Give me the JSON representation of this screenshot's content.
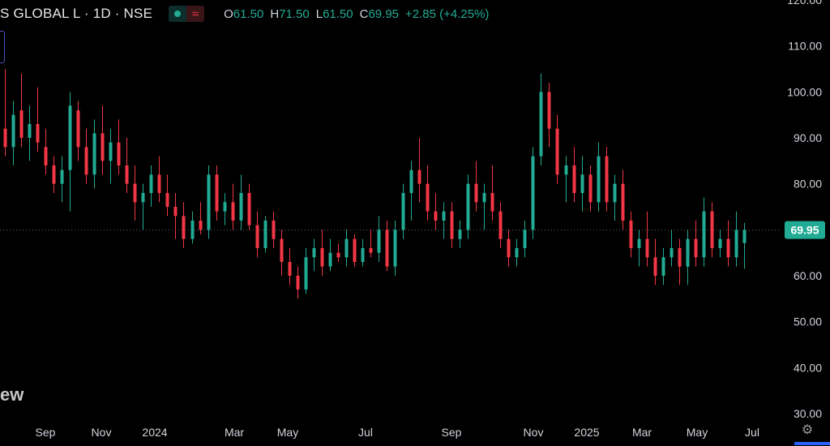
{
  "header": {
    "symbol": "S GLOBAL L · 1D · NSE",
    "status_icon": "green-dot-icon",
    "indicator_icon": "wave-icon",
    "indicator_glyph": "≈",
    "open_label": "O",
    "open": "61.50",
    "high_label": "H",
    "high": "71.50",
    "low_label": "L",
    "low": "61.50",
    "close_label": "C",
    "close": "69.95",
    "change": "+2.85 (+4.25%)"
  },
  "watermark": "ew",
  "settings_icon": "settings-icon",
  "price_label": "69.95",
  "colors": {
    "up": "#22ab94",
    "down": "#f23645",
    "background": "#000000",
    "axis_text": "#d1d4dc"
  },
  "chart_data": {
    "type": "candlestick",
    "ylim": [
      30,
      120
    ],
    "y_ticks": [
      "120.00",
      "110.00",
      "100.00",
      "90.00",
      "80.00",
      "70.00",
      "60.00",
      "50.00",
      "40.00",
      "30.00"
    ],
    "x_ticks": [
      "Sep",
      "Nov",
      "2024",
      "Mar",
      "May",
      "Jul",
      "Sep",
      "Nov",
      "2025",
      "Mar",
      "May",
      "Jul"
    ],
    "last_price": 69.95,
    "series": [
      {
        "o": 92,
        "h": 105,
        "l": 86,
        "c": 88
      },
      {
        "o": 88,
        "h": 98,
        "l": 84,
        "c": 95
      },
      {
        "o": 96,
        "h": 104,
        "l": 88,
        "c": 90
      },
      {
        "o": 90,
        "h": 97,
        "l": 85,
        "c": 93
      },
      {
        "o": 93,
        "h": 101,
        "l": 87,
        "c": 89
      },
      {
        "o": 88,
        "h": 92,
        "l": 82,
        "c": 84
      },
      {
        "o": 84,
        "h": 86,
        "l": 78,
        "c": 80
      },
      {
        "o": 80,
        "h": 86,
        "l": 76,
        "c": 83
      },
      {
        "o": 83,
        "h": 100,
        "l": 74,
        "c": 97
      },
      {
        "o": 96,
        "h": 98,
        "l": 85,
        "c": 88
      },
      {
        "o": 88,
        "h": 92,
        "l": 80,
        "c": 82
      },
      {
        "o": 82,
        "h": 94,
        "l": 79,
        "c": 91
      },
      {
        "o": 91,
        "h": 97,
        "l": 82,
        "c": 85
      },
      {
        "o": 85,
        "h": 92,
        "l": 80,
        "c": 89
      },
      {
        "o": 89,
        "h": 94,
        "l": 82,
        "c": 84
      },
      {
        "o": 84,
        "h": 90,
        "l": 78,
        "c": 80
      },
      {
        "o": 80,
        "h": 84,
        "l": 72,
        "c": 76
      },
      {
        "o": 76,
        "h": 80,
        "l": 70,
        "c": 78
      },
      {
        "o": 78,
        "h": 84,
        "l": 75,
        "c": 82
      },
      {
        "o": 82,
        "h": 86,
        "l": 76,
        "c": 78
      },
      {
        "o": 78,
        "h": 82,
        "l": 73,
        "c": 75
      },
      {
        "o": 75,
        "h": 78,
        "l": 68,
        "c": 73
      },
      {
        "o": 73,
        "h": 76,
        "l": 66,
        "c": 68
      },
      {
        "o": 68,
        "h": 74,
        "l": 67,
        "c": 72
      },
      {
        "o": 72,
        "h": 76,
        "l": 69,
        "c": 70
      },
      {
        "o": 70,
        "h": 84,
        "l": 68,
        "c": 82
      },
      {
        "o": 82,
        "h": 84,
        "l": 72,
        "c": 74
      },
      {
        "o": 74,
        "h": 78,
        "l": 71,
        "c": 76
      },
      {
        "o": 76,
        "h": 80,
        "l": 70,
        "c": 72
      },
      {
        "o": 72,
        "h": 82,
        "l": 70,
        "c": 78
      },
      {
        "o": 78,
        "h": 80,
        "l": 70,
        "c": 71
      },
      {
        "o": 71,
        "h": 74,
        "l": 64,
        "c": 66
      },
      {
        "o": 66,
        "h": 73,
        "l": 65,
        "c": 72
      },
      {
        "o": 72,
        "h": 74,
        "l": 66,
        "c": 68
      },
      {
        "o": 68,
        "h": 70,
        "l": 60,
        "c": 63
      },
      {
        "o": 63,
        "h": 66,
        "l": 58,
        "c": 60
      },
      {
        "o": 60,
        "h": 62,
        "l": 55,
        "c": 57
      },
      {
        "o": 57,
        "h": 66,
        "l": 56,
        "c": 64
      },
      {
        "o": 64,
        "h": 68,
        "l": 61,
        "c": 66
      },
      {
        "o": 66,
        "h": 70,
        "l": 60,
        "c": 62
      },
      {
        "o": 62,
        "h": 68,
        "l": 61,
        "c": 65
      },
      {
        "o": 65,
        "h": 67,
        "l": 63,
        "c": 64
      },
      {
        "o": 64,
        "h": 70,
        "l": 62,
        "c": 68
      },
      {
        "o": 68,
        "h": 69,
        "l": 62,
        "c": 63
      },
      {
        "o": 63,
        "h": 68,
        "l": 62,
        "c": 66
      },
      {
        "o": 66,
        "h": 70,
        "l": 64,
        "c": 65
      },
      {
        "o": 65,
        "h": 73,
        "l": 63,
        "c": 70
      },
      {
        "o": 70,
        "h": 72,
        "l": 61,
        "c": 62
      },
      {
        "o": 62,
        "h": 72,
        "l": 60,
        "c": 70
      },
      {
        "o": 70,
        "h": 80,
        "l": 68,
        "c": 78
      },
      {
        "o": 78,
        "h": 85,
        "l": 72,
        "c": 83
      },
      {
        "o": 83,
        "h": 90,
        "l": 76,
        "c": 80
      },
      {
        "o": 80,
        "h": 84,
        "l": 72,
        "c": 74
      },
      {
        "o": 74,
        "h": 78,
        "l": 70,
        "c": 72
      },
      {
        "o": 72,
        "h": 76,
        "l": 68,
        "c": 74
      },
      {
        "o": 74,
        "h": 76,
        "l": 66,
        "c": 68
      },
      {
        "o": 68,
        "h": 72,
        "l": 66,
        "c": 70
      },
      {
        "o": 70,
        "h": 82,
        "l": 68,
        "c": 80
      },
      {
        "o": 80,
        "h": 85,
        "l": 74,
        "c": 76
      },
      {
        "o": 76,
        "h": 80,
        "l": 70,
        "c": 78
      },
      {
        "o": 78,
        "h": 84,
        "l": 72,
        "c": 74
      },
      {
        "o": 74,
        "h": 76,
        "l": 66,
        "c": 68
      },
      {
        "o": 68,
        "h": 70,
        "l": 62,
        "c": 64
      },
      {
        "o": 64,
        "h": 68,
        "l": 62,
        "c": 66
      },
      {
        "o": 66,
        "h": 72,
        "l": 64,
        "c": 70
      },
      {
        "o": 70,
        "h": 88,
        "l": 68,
        "c": 86
      },
      {
        "o": 86,
        "h": 104,
        "l": 84,
        "c": 100
      },
      {
        "o": 100,
        "h": 102,
        "l": 88,
        "c": 92
      },
      {
        "o": 92,
        "h": 95,
        "l": 80,
        "c": 82
      },
      {
        "o": 82,
        "h": 86,
        "l": 76,
        "c": 84
      },
      {
        "o": 84,
        "h": 88,
        "l": 76,
        "c": 78
      },
      {
        "o": 78,
        "h": 86,
        "l": 74,
        "c": 82
      },
      {
        "o": 82,
        "h": 84,
        "l": 74,
        "c": 76
      },
      {
        "o": 76,
        "h": 89,
        "l": 74,
        "c": 86
      },
      {
        "o": 86,
        "h": 88,
        "l": 74,
        "c": 76
      },
      {
        "o": 76,
        "h": 82,
        "l": 72,
        "c": 80
      },
      {
        "o": 80,
        "h": 83,
        "l": 70,
        "c": 72
      },
      {
        "o": 72,
        "h": 74,
        "l": 64,
        "c": 66
      },
      {
        "o": 66,
        "h": 70,
        "l": 62,
        "c": 68
      },
      {
        "o": 68,
        "h": 74,
        "l": 62,
        "c": 64
      },
      {
        "o": 64,
        "h": 68,
        "l": 58,
        "c": 60
      },
      {
        "o": 60,
        "h": 66,
        "l": 58,
        "c": 64
      },
      {
        "o": 64,
        "h": 70,
        "l": 62,
        "c": 66
      },
      {
        "o": 66,
        "h": 68,
        "l": 58,
        "c": 62
      },
      {
        "o": 62,
        "h": 70,
        "l": 58,
        "c": 68
      },
      {
        "o": 68,
        "h": 72,
        "l": 62,
        "c": 64
      },
      {
        "o": 64,
        "h": 77,
        "l": 62,
        "c": 74
      },
      {
        "o": 74,
        "h": 76,
        "l": 64,
        "c": 66
      },
      {
        "o": 66,
        "h": 70,
        "l": 64,
        "c": 68
      },
      {
        "o": 68,
        "h": 72,
        "l": 62,
        "c": 64
      },
      {
        "o": 64,
        "h": 74,
        "l": 62,
        "c": 70
      },
      {
        "o": 67.1,
        "h": 71.5,
        "l": 61.5,
        "c": 69.95
      }
    ]
  }
}
